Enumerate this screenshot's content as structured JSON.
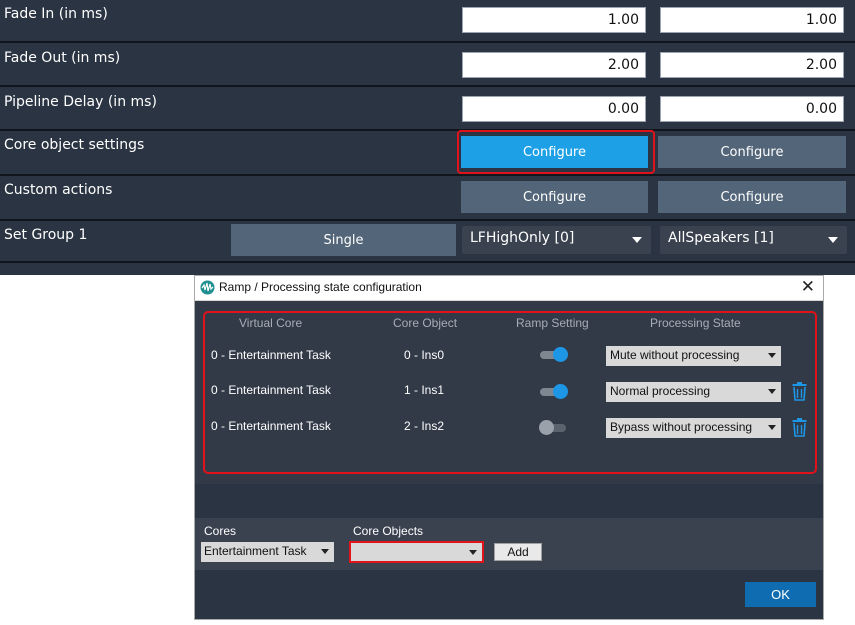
{
  "settings": {
    "fade_in": {
      "label": "Fade In (in ms)",
      "value_a": "1.00",
      "value_b": "1.00"
    },
    "fade_out": {
      "label": "Fade Out (in ms)",
      "value_a": "2.00",
      "value_b": "2.00"
    },
    "pipeline_delay": {
      "label": "Pipeline Delay (in ms)",
      "value_a": "0.00",
      "value_b": "0.00"
    },
    "core_object": {
      "label": "Core object settings",
      "button_a": "Configure",
      "button_b": "Configure"
    },
    "custom_actions": {
      "label": "Custom actions",
      "button_a": "Configure",
      "button_b": "Configure"
    },
    "set_group": {
      "label": "Set Group 1",
      "button": "Single",
      "combo_a": "LFHighOnly [0]",
      "combo_b": "AllSpeakers [1]"
    }
  },
  "dialog": {
    "title": "Ramp / Processing state configuration",
    "close": "✕",
    "columns": [
      "Virtual Core",
      "Core Object",
      "Ramp Setting",
      "Processing State"
    ],
    "rows": [
      {
        "core": "0 - Entertainment Task",
        "object": "0 - Ins0",
        "ramp_on": true,
        "state": "Mute without processing",
        "deletable": false
      },
      {
        "core": "0 - Entertainment Task",
        "object": "1 - Ins1",
        "ramp_on": true,
        "state": "Normal processing",
        "deletable": true
      },
      {
        "core": "0 - Entertainment Task",
        "object": "2 - Ins2",
        "ramp_on": false,
        "state": "Bypass without processing",
        "deletable": true
      }
    ],
    "cores_label": "Cores",
    "cores_value": "Entertainment Task",
    "core_objects_label": "Core Objects",
    "core_objects_value": "",
    "add_label": "Add",
    "ok_label": "OK"
  },
  "colors": {
    "panel_bg": "#2b3442",
    "accent": "#1ea0e6",
    "highlight": "#e0121b",
    "toggle_on": "#1e96e6",
    "ok_button": "#0f6cb0"
  }
}
